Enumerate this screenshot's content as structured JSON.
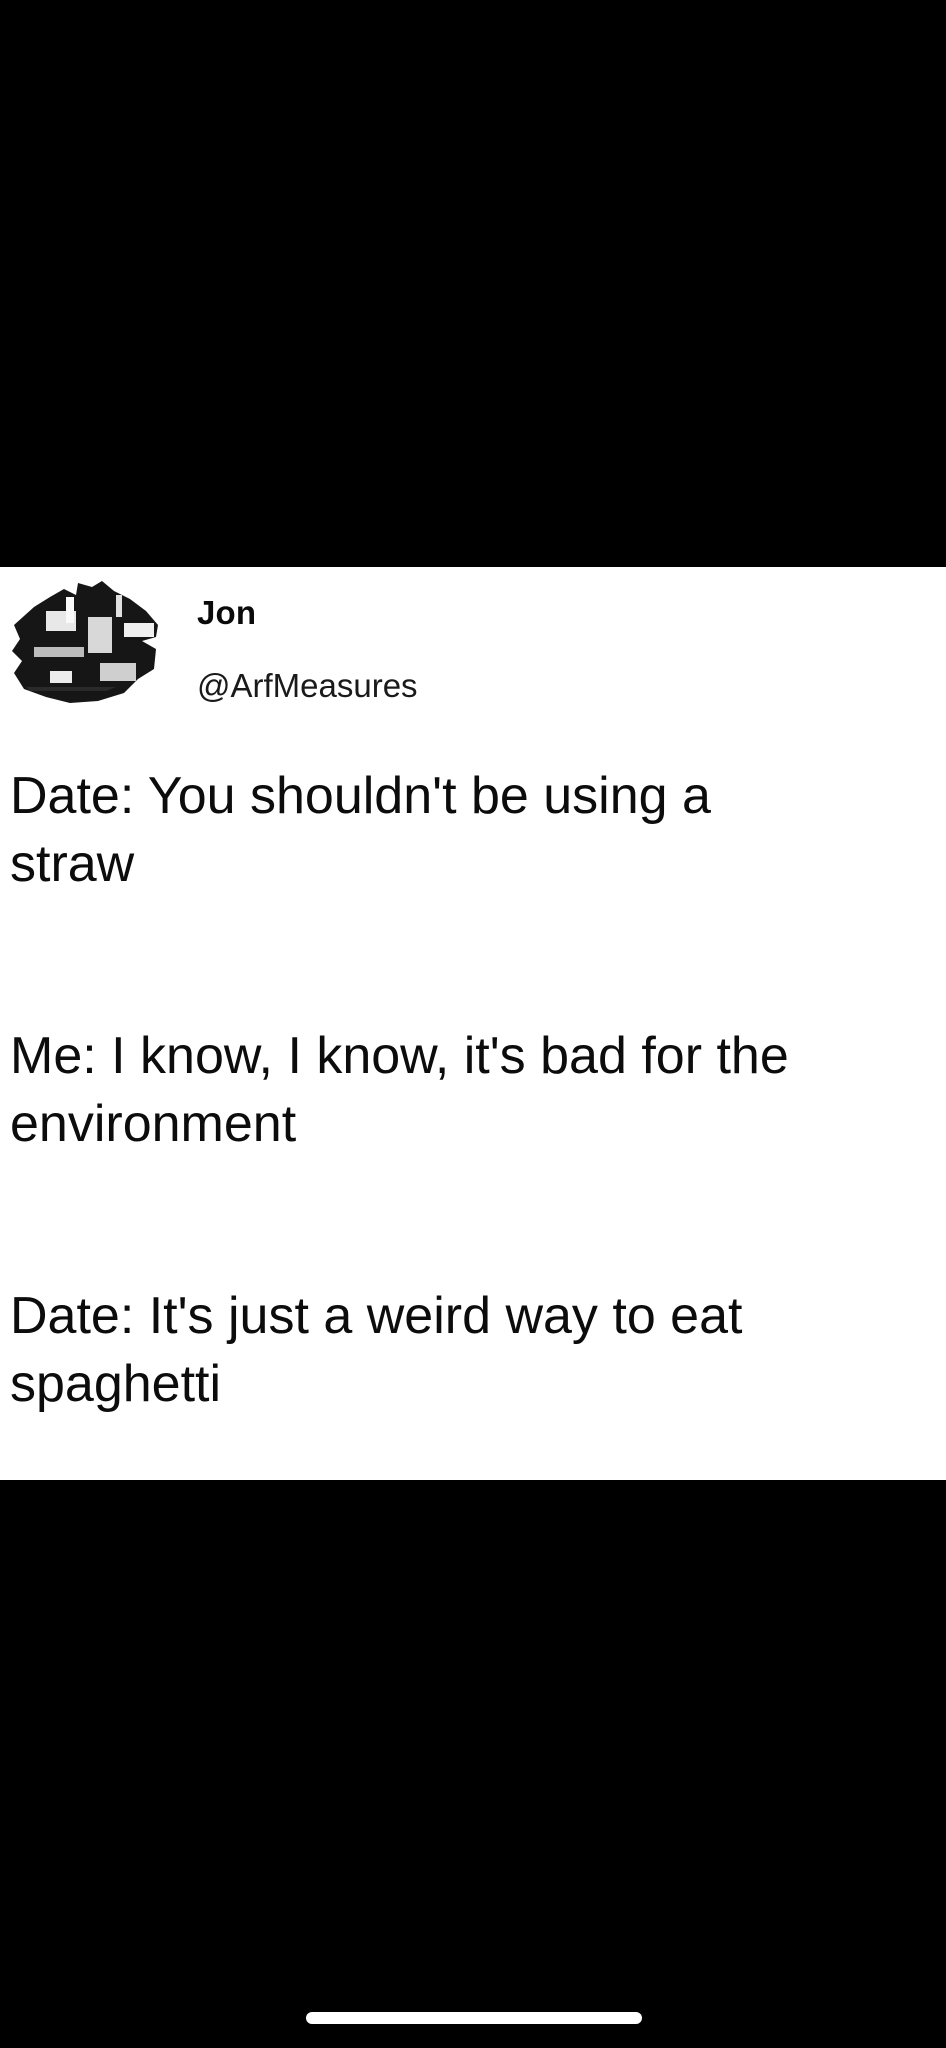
{
  "tweet": {
    "author": {
      "display_name": "Jon",
      "handle": "@ArfMeasures",
      "avatar_icon": "avatar-image-icon"
    },
    "paragraphs": [
      {
        "lines": [
          "Date: You shouldn't be using a",
          "straw"
        ]
      },
      {
        "lines": [
          "Me: I know, I know, it's bad for the",
          "environment"
        ]
      },
      {
        "lines": [
          "Date: It's just a weird way to eat",
          "spaghetti"
        ]
      }
    ]
  },
  "colors": {
    "background": "#000000",
    "card": "#ffffff",
    "text": "#0c0c0c",
    "home_indicator": "#ffffff"
  }
}
